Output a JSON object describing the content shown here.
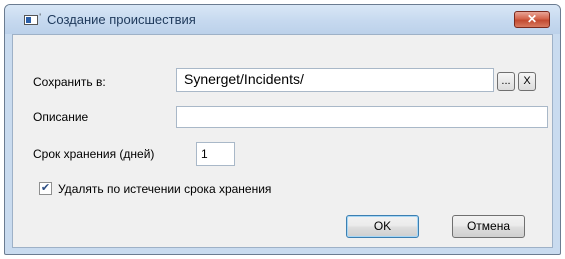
{
  "window": {
    "title": "Создание происшествия",
    "close_label": "✕"
  },
  "form": {
    "save_to_label": "Сохранить в:",
    "save_to_value": "Synerget/Incidents/",
    "browse_label": "...",
    "clear_label": "X",
    "description_label": "Описание",
    "description_value": "",
    "retention_label": "Срок хранения (дней)",
    "retention_value": "1",
    "delete_checkbox_label": "Удалять по истечении срока хранения",
    "delete_checked": true
  },
  "buttons": {
    "ok_label": "OK",
    "cancel_label": "Отмена"
  },
  "colors": {
    "titlebar": "#c6d9ef",
    "client_bg": "#f0f0f0",
    "close_red": "#c24a31"
  }
}
